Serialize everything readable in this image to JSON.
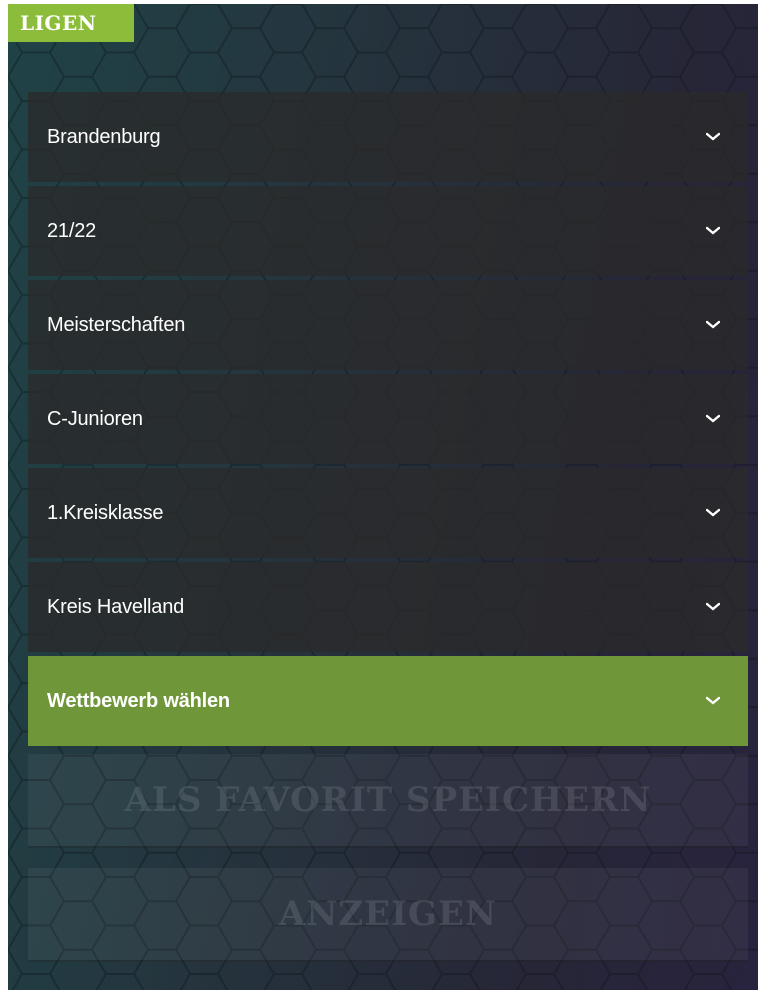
{
  "header": {
    "title": "LIGEN"
  },
  "filters": [
    {
      "label": "Brandenburg"
    },
    {
      "label": "21/22"
    },
    {
      "label": "Meisterschaften"
    },
    {
      "label": "C-Junioren"
    },
    {
      "label": "1.Kreisklasse"
    },
    {
      "label": "Kreis Havelland"
    },
    {
      "label": "Wettbewerb wählen",
      "active": true
    }
  ],
  "actions": {
    "save_favorite_label": "ALS FAVORIT SPEICHERN",
    "show_label": "ANZEIGEN"
  },
  "colors": {
    "accent": "#8cbd3a",
    "active_row": "#6f9639",
    "row_bg": "#2a2a2a",
    "text": "#ffffff"
  },
  "icons": {
    "dropdown": "chevron-down-icon"
  }
}
